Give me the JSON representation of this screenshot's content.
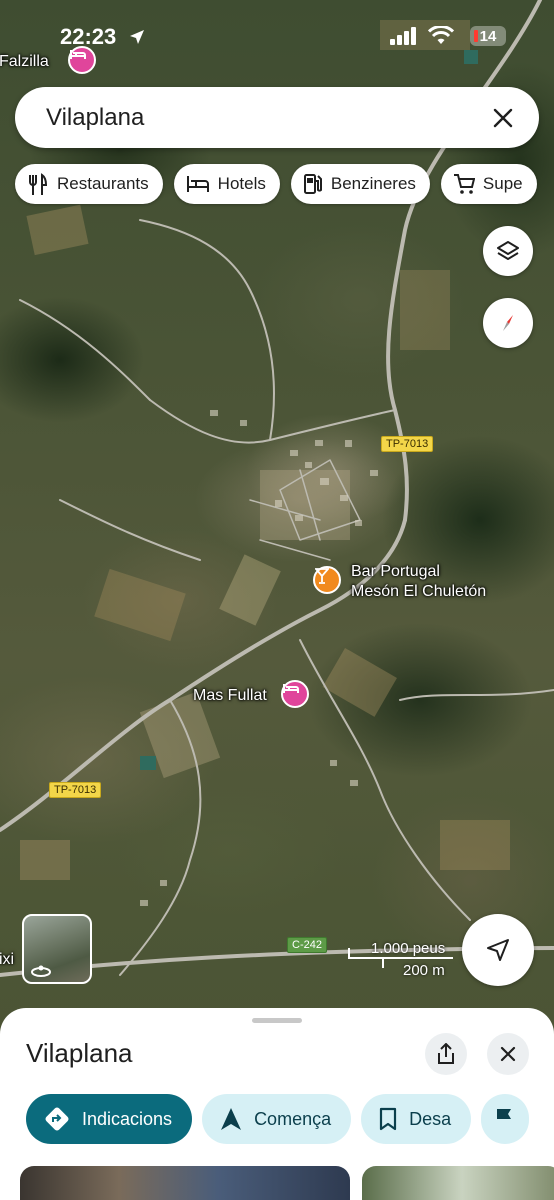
{
  "status_bar": {
    "time": "22:23",
    "battery": "14"
  },
  "search": {
    "value": "Vilaplana"
  },
  "chips": [
    {
      "label": "Restaurants",
      "icon": "fork-knife-icon"
    },
    {
      "label": "Hotels",
      "icon": "bed-icon"
    },
    {
      "label": "Benzineres",
      "icon": "gas-station-icon"
    },
    {
      "label": "Supe",
      "icon": "shopping-cart-icon"
    }
  ],
  "map": {
    "places": {
      "top_left_hotel": "Falzilla",
      "bar": "Bar Portugal\nMesón El Chuletón",
      "hotel": "Mas Fullat",
      "left_edge_place": "ixi"
    },
    "road_labels": {
      "tp7013_upper": "TP-7013",
      "tp7013_lower": "TP-7013",
      "c242": "C-242"
    },
    "scale": {
      "imperial": "1.000 peus",
      "metric": "200 m"
    }
  },
  "sheet": {
    "title": "Vilaplana",
    "actions": [
      {
        "label": "Indicacions",
        "icon": "directions-icon"
      },
      {
        "label": "Comença",
        "icon": "navigation-arrow-icon"
      },
      {
        "label": "Desa",
        "icon": "bookmark-icon"
      }
    ]
  },
  "colors": {
    "primary_action": "#0b6b7d",
    "secondary_action": "#d6f0f5",
    "hotel_pin": "#e0459b",
    "bar_pin": "#f18a1e",
    "road_label": "#f3d649",
    "road_label_green": "#5d9b47"
  }
}
